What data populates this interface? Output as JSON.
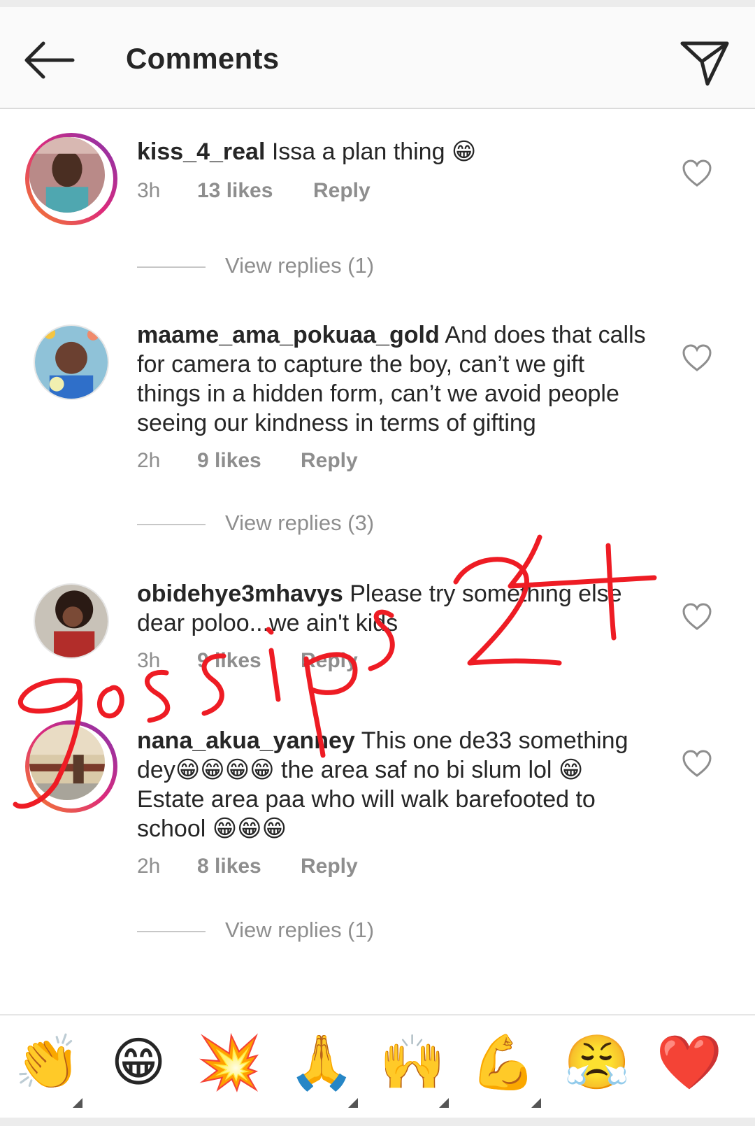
{
  "header": {
    "title": "Comments",
    "back_icon": "arrow-left-icon",
    "share_icon": "paper-plane-icon"
  },
  "comments": [
    {
      "username": "kiss_4_real",
      "text": "Issa a plan thing 😁",
      "time": "3h",
      "likes": "13 likes",
      "reply": "Reply",
      "view_replies": "View replies (1)",
      "story_ring": true
    },
    {
      "username": "maame_ama_pokuaa_gold",
      "text": "And does that calls for camera to capture the boy, can’t we gift things in a hidden form, can’t we avoid people seeing our kindness in terms of gifting",
      "time": "2h",
      "likes": "9 likes",
      "reply": "Reply",
      "view_replies": "View replies (3)",
      "story_ring": false
    },
    {
      "username": "obidehye3mhavys",
      "text": "Please try something else dear poloo...we ain't kids",
      "time": "3h",
      "likes": "9 likes",
      "reply": "Reply",
      "story_ring": false
    },
    {
      "username": "nana_akua_yanney",
      "text": "This one de33 something dey😁😁😁😁 the area saf no bi slum lol 😁 Estate area paa who will walk barefooted to school 😁😁😁",
      "time": "2h",
      "likes": "8 likes",
      "reply": "Reply",
      "view_replies": "View replies (1)",
      "story_ring": true
    }
  ],
  "watermark": {
    "text": "gossips 24",
    "color": "#ee1c24"
  },
  "emoji_bar": [
    "👏",
    "😁",
    "💥",
    "🙏",
    "🙌",
    "💪",
    "😤",
    "❤️"
  ],
  "colors": {
    "text": "#262626",
    "secondary": "#8e8e8e",
    "ring_start": "#f58529",
    "ring_end": "#8134af"
  }
}
